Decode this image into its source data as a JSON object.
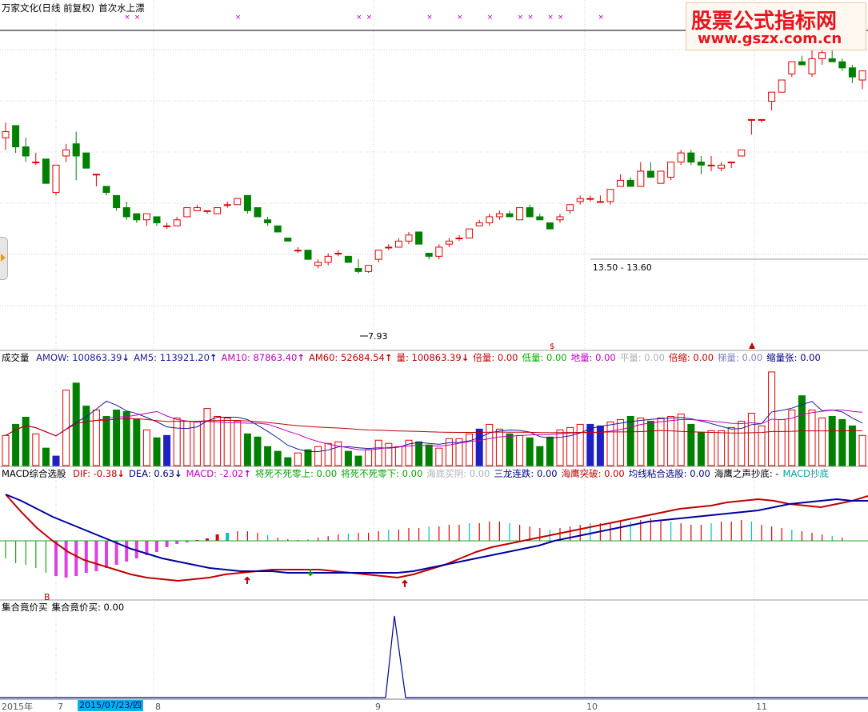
{
  "title": "万家文化(日线 前复权)",
  "signal_title": "首次水上漂",
  "logo": {
    "line1": "股票公式指标网",
    "line2": "www.gszx.com.cn"
  },
  "price_labels": {
    "low": "7.93",
    "range": "13.50 - 13.60",
    "dollar_marker": "$"
  },
  "volume_header": {
    "name": "成交量",
    "items": [
      {
        "label": "AMOW: 100863.39",
        "color": "#1a1aa0",
        "dir": "dn"
      },
      {
        "label": "AM5: 113921.20",
        "color": "#1a1aa0",
        "dir": "up"
      },
      {
        "label": "AM10: 87863.40",
        "color": "#c000c0",
        "dir": "up"
      },
      {
        "label": "AM60: 52684.54",
        "color": "#c00000",
        "dir": "up"
      },
      {
        "label": "量: 100863.39",
        "color": "#c00000",
        "dir": "dn"
      },
      {
        "label": "倍量: 0.00",
        "color": "#c00000",
        "dir": ""
      },
      {
        "label": "低量: 0.00",
        "color": "#00b000",
        "dir": ""
      },
      {
        "label": "地量: 0.00",
        "color": "#c000c0",
        "dir": ""
      },
      {
        "label": "平量: 0.00",
        "color": "#b0b0b0",
        "dir": ""
      },
      {
        "label": "倍缩: 0.00",
        "color": "#c00000",
        "dir": ""
      },
      {
        "label": "梯量: 0.00",
        "color": "#8080c0",
        "dir": ""
      },
      {
        "label": "缩量张: 0.00",
        "color": "#000080",
        "dir": ""
      }
    ]
  },
  "macd_header": {
    "name": "MACD综合选股",
    "items": [
      {
        "label": "DIF: -0.38",
        "color": "#c00000",
        "dir": "dn"
      },
      {
        "label": "DEA: 0.63",
        "color": "#000080",
        "dir": "dn"
      },
      {
        "label": "MACD: -2.02",
        "color": "#c000c0",
        "dir": "up"
      },
      {
        "label": "将死不死零上: 0.00",
        "color": "#00a000",
        "dir": ""
      },
      {
        "label": "将死不死零下: 0.00",
        "color": "#00a000",
        "dir": ""
      },
      {
        "label": "海底买阴: 0.00",
        "color": "#b0b0b0",
        "dir": ""
      },
      {
        "label": "三龙连跌: 0.00",
        "color": "#000080",
        "dir": ""
      },
      {
        "label": "海鹰突破: 0.00",
        "color": "#c00000",
        "dir": ""
      },
      {
        "label": "均线粘合选股: 0.00",
        "color": "#000080",
        "dir": ""
      },
      {
        "label": "海鹰之声抄底: -",
        "color": "#000000",
        "dir": ""
      },
      {
        "label": "MACD抄底",
        "color": "#00a0a0",
        "dir": ""
      }
    ]
  },
  "auction_header": {
    "name": "集合竟价买",
    "item": "集合竟价买: 0.00"
  },
  "axis": {
    "year_label": "2015年",
    "month_ticks": [
      "7",
      "8",
      "9",
      "10",
      "11"
    ],
    "selected_date": "2015/07/23/四"
  },
  "markers": {
    "b_label": "B"
  },
  "colors": {
    "up": "#e00000",
    "down": "#008000",
    "dif": "#c00000",
    "dea": "#0000a0"
  },
  "chart_data": {
    "type": "candlestick",
    "title": "万家文化(日线 前复权)",
    "candles": [
      {
        "o": 14.4,
        "h": 14.9,
        "l": 14.0,
        "c": 14.6
      },
      {
        "o": 14.8,
        "h": 14.3,
        "l": 13.9,
        "c": 14.1
      },
      {
        "o": 14.1,
        "h": 14.4,
        "l": 13.6,
        "c": 13.8
      },
      {
        "o": 13.6,
        "h": 13.9,
        "l": 13.5,
        "c": 13.6
      },
      {
        "o": 13.7,
        "h": 13.7,
        "l": 12.9,
        "c": 12.9
      },
      {
        "o": 12.6,
        "h": 13.5,
        "l": 12.5,
        "c": 13.5
      },
      {
        "o": 13.8,
        "h": 14.2,
        "l": 13.6,
        "c": 14.0
      },
      {
        "o": 14.2,
        "h": 14.6,
        "l": 13.0,
        "c": 13.8
      },
      {
        "o": 13.9,
        "h": 13.9,
        "l": 13.4,
        "c": 13.4
      },
      {
        "o": 13.2,
        "h": 13.2,
        "l": 12.8,
        "c": 13.2
      },
      {
        "o": 12.8,
        "h": 12.8,
        "l": 12.5,
        "c": 12.6
      },
      {
        "o": 12.5,
        "h": 12.5,
        "l": 12.0,
        "c": 12.1
      },
      {
        "o": 12.1,
        "h": 12.3,
        "l": 11.7,
        "c": 11.8
      },
      {
        "o": 11.9,
        "h": 11.9,
        "l": 11.6,
        "c": 11.7
      },
      {
        "o": 11.7,
        "h": 11.9,
        "l": 11.5,
        "c": 11.9
      },
      {
        "o": 11.8,
        "h": 11.8,
        "l": 11.5,
        "c": 11.6
      },
      {
        "o": 11.5,
        "h": 11.6,
        "l": 11.4,
        "c": 11.5
      },
      {
        "o": 11.5,
        "h": 11.8,
        "l": 11.5,
        "c": 11.7
      },
      {
        "o": 11.8,
        "h": 12.1,
        "l": 11.8,
        "c": 12.1
      },
      {
        "o": 12.0,
        "h": 12.2,
        "l": 12.0,
        "c": 12.1
      },
      {
        "o": 12.0,
        "h": 12.0,
        "l": 11.9,
        "c": 12.0
      },
      {
        "o": 11.9,
        "h": 12.1,
        "l": 11.9,
        "c": 12.1
      },
      {
        "o": 12.2,
        "h": 12.3,
        "l": 12.1,
        "c": 12.2
      },
      {
        "o": 12.2,
        "h": 12.4,
        "l": 12.2,
        "c": 12.4
      },
      {
        "o": 12.5,
        "h": 12.5,
        "l": 11.9,
        "c": 12.0
      },
      {
        "o": 12.1,
        "h": 12.1,
        "l": 11.8,
        "c": 11.8
      },
      {
        "o": 11.7,
        "h": 11.8,
        "l": 11.5,
        "c": 11.6
      },
      {
        "o": 11.5,
        "h": 11.5,
        "l": 11.3,
        "c": 11.3
      },
      {
        "o": 11.1,
        "h": 11.1,
        "l": 11.0,
        "c": 11.0
      },
      {
        "o": 10.7,
        "h": 10.8,
        "l": 10.6,
        "c": 10.7
      },
      {
        "o": 10.7,
        "h": 10.7,
        "l": 10.4,
        "c": 10.4
      },
      {
        "o": 10.2,
        "h": 10.4,
        "l": 10.1,
        "c": 10.3
      },
      {
        "o": 10.3,
        "h": 10.6,
        "l": 10.2,
        "c": 10.5
      },
      {
        "o": 10.6,
        "h": 10.7,
        "l": 10.5,
        "c": 10.6
      },
      {
        "o": 10.5,
        "h": 10.5,
        "l": 10.3,
        "c": 10.3
      },
      {
        "o": 10.1,
        "h": 10.4,
        "l": 9.93,
        "c": 10.0
      },
      {
        "o": 10.0,
        "h": 10.2,
        "l": 9.95,
        "c": 10.2
      },
      {
        "o": 10.4,
        "h": 10.7,
        "l": 10.3,
        "c": 10.7
      },
      {
        "o": 10.8,
        "h": 10.9,
        "l": 10.7,
        "c": 10.8
      },
      {
        "o": 10.8,
        "h": 11.1,
        "l": 10.8,
        "c": 11.0
      },
      {
        "o": 11.0,
        "h": 11.3,
        "l": 10.9,
        "c": 11.2
      },
      {
        "o": 11.3,
        "h": 11.3,
        "l": 10.9,
        "c": 10.9
      },
      {
        "o": 10.6,
        "h": 10.6,
        "l": 10.4,
        "c": 10.5
      },
      {
        "o": 10.5,
        "h": 10.9,
        "l": 10.4,
        "c": 10.8
      },
      {
        "o": 10.9,
        "h": 11.1,
        "l": 10.8,
        "c": 11.0
      },
      {
        "o": 11.1,
        "h": 11.2,
        "l": 11.0,
        "c": 11.1
      },
      {
        "o": 11.1,
        "h": 11.4,
        "l": 11.1,
        "c": 11.4
      },
      {
        "o": 11.5,
        "h": 11.7,
        "l": 11.5,
        "c": 11.6
      },
      {
        "o": 11.6,
        "h": 11.9,
        "l": 11.5,
        "c": 11.8
      },
      {
        "o": 11.8,
        "h": 12.0,
        "l": 11.7,
        "c": 11.9
      },
      {
        "o": 11.9,
        "h": 12.0,
        "l": 11.8,
        "c": 11.8
      },
      {
        "o": 11.7,
        "h": 12.1,
        "l": 11.7,
        "c": 12.1
      },
      {
        "o": 12.1,
        "h": 12.2,
        "l": 11.8,
        "c": 11.8
      },
      {
        "o": 11.8,
        "h": 11.9,
        "l": 11.7,
        "c": 11.7
      },
      {
        "o": 11.6,
        "h": 11.6,
        "l": 11.4,
        "c": 11.4
      },
      {
        "o": 11.7,
        "h": 11.9,
        "l": 11.6,
        "c": 11.8
      },
      {
        "o": 12.0,
        "h": 12.2,
        "l": 11.9,
        "c": 12.2
      },
      {
        "o": 12.3,
        "h": 12.5,
        "l": 12.2,
        "c": 12.4
      },
      {
        "o": 12.4,
        "h": 12.5,
        "l": 12.3,
        "c": 12.4
      },
      {
        "o": 12.3,
        "h": 12.5,
        "l": 12.3,
        "c": 12.3
      },
      {
        "o": 12.3,
        "h": 12.7,
        "l": 12.2,
        "c": 12.7
      },
      {
        "o": 12.8,
        "h": 13.2,
        "l": 12.8,
        "c": 13.0
      },
      {
        "o": 13.0,
        "h": 13.1,
        "l": 12.8,
        "c": 12.8
      },
      {
        "o": 12.8,
        "h": 13.6,
        "l": 12.8,
        "c": 13.3
      },
      {
        "o": 13.3,
        "h": 13.6,
        "l": 13.1,
        "c": 13.1
      },
      {
        "o": 12.9,
        "h": 13.3,
        "l": 12.9,
        "c": 13.3
      },
      {
        "o": 13.1,
        "h": 13.4,
        "l": 13.0,
        "c": 13.6
      },
      {
        "o": 13.6,
        "h": 14.0,
        "l": 13.5,
        "c": 13.9
      },
      {
        "o": 13.9,
        "h": 14.0,
        "l": 13.5,
        "c": 13.6
      },
      {
        "o": 13.6,
        "h": 13.8,
        "l": 13.2,
        "c": 13.5
      },
      {
        "o": 13.5,
        "h": 13.8,
        "l": 13.3,
        "c": 13.5
      },
      {
        "o": 13.4,
        "h": 13.6,
        "l": 13.3,
        "c": 13.5
      },
      {
        "o": 13.6,
        "h": 13.6,
        "l": 13.4,
        "c": 13.6
      },
      {
        "o": 13.8,
        "h": 14.0,
        "l": 13.8,
        "c": 14.0
      },
      {
        "o": 15.0,
        "h": 15.0,
        "l": 14.5,
        "c": 15.0
      },
      {
        "o": 15.0,
        "h": 15.0,
        "l": 14.9,
        "c": 15.0
      },
      {
        "o": 15.6,
        "h": 15.9,
        "l": 15.3,
        "c": 15.9
      },
      {
        "o": 15.9,
        "h": 16.3,
        "l": 15.9,
        "c": 16.3
      },
      {
        "o": 16.5,
        "h": 16.9,
        "l": 16.4,
        "c": 16.9
      },
      {
        "o": 16.9,
        "h": 17.1,
        "l": 16.8,
        "c": 16.8
      },
      {
        "o": 16.5,
        "h": 17.3,
        "l": 16.4,
        "c": 17.0
      },
      {
        "o": 17.0,
        "h": 17.3,
        "l": 16.8,
        "c": 17.2
      },
      {
        "o": 17.0,
        "h": 17.4,
        "l": 16.9,
        "c": 16.9
      },
      {
        "o": 16.9,
        "h": 17.0,
        "l": 16.6,
        "c": 16.7
      },
      {
        "o": 16.7,
        "h": 16.8,
        "l": 16.2,
        "c": 16.4
      },
      {
        "o": 16.3,
        "h": 16.6,
        "l": 16.0,
        "c": 16.6
      }
    ]
  }
}
